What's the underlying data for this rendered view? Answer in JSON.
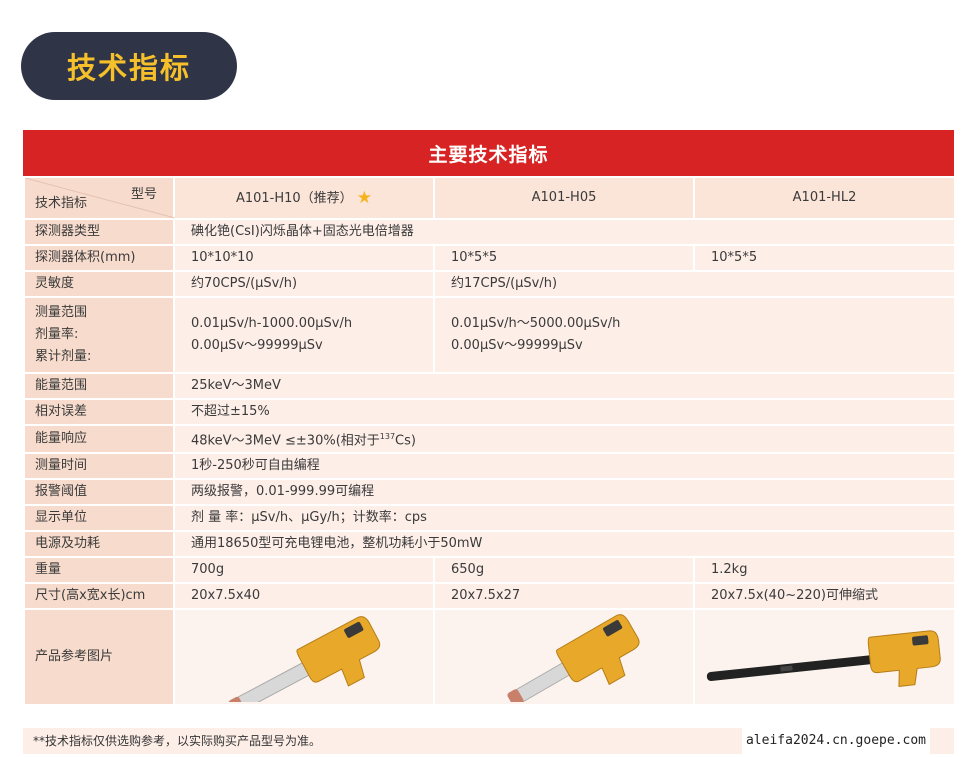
{
  "badge_title": "技术指标",
  "table_title": "主要技术指标",
  "header": {
    "corner_top": "型号",
    "corner_bottom": "技术指标",
    "models": [
      "A101-H10（推荐）",
      "A101-H05",
      "A101-HL2"
    ]
  },
  "rows": {
    "detector_type": {
      "label": "探测器类型",
      "value": "碘化铯(CsI)闪烁晶体+固态光电倍增器"
    },
    "detector_volume": {
      "label": "探测器体积(mm)",
      "v1": "10*10*10",
      "v2": "10*5*5",
      "v3": "10*5*5"
    },
    "sensitivity": {
      "label": "灵敏度",
      "v1": "约70CPS/(μSv/h)",
      "v2": "约17CPS/(μSv/h)"
    },
    "range": {
      "label1": "测量范围",
      "label2": "剂量率:",
      "label3": "累计剂量:",
      "v1a": "0.01μSv/h-1000.00μSv/h",
      "v1b": "0.00μSv～99999μSv",
      "v2a": "0.01μSv/h～5000.00μSv/h",
      "v2b": "0.00μSv～99999μSv"
    },
    "energy_range": {
      "label": "能量范围",
      "value": "25keV～3MeV"
    },
    "relative_error": {
      "label": "相对误差",
      "value": "不超过±15%"
    },
    "energy_response": {
      "label": "能量响应",
      "value_a": "48keV～3MeV ≤±30%(相对于",
      "value_sup": "137",
      "value_b": "Cs)"
    },
    "measure_time": {
      "label": "测量时间",
      "value": "1秒-250秒可自由编程"
    },
    "alarm": {
      "label": "报警阈值",
      "value": "两级报警，0.01-999.99可编程"
    },
    "display_unit": {
      "label": "显示单位",
      "value": "剂 量 率：μSv/h、μGy/h；计数率：cps"
    },
    "power": {
      "label": "电源及功耗",
      "value": "通用18650型可充电锂电池，整机功耗小于50mW"
    },
    "weight": {
      "label": "重量",
      "v1": "700g",
      "v2": "650g",
      "v3": "1.2kg"
    },
    "size": {
      "label": "尺寸(高x宽x长)cm",
      "v1": "20x7.5x40",
      "v2": "20x7.5x27",
      "v3": "20x7.5x(40~220)可伸缩式"
    },
    "images": {
      "label": "产品参考图片"
    }
  },
  "footer_note": "**技术指标仅供选购参考，以实际购买产品型号为准。",
  "watermark": "aleifa2024.cn.goepe.com",
  "colors": {
    "title_bar": "#d72323",
    "badge_bg": "#2f3546",
    "badge_text": "#f6c02b",
    "device_body": "#e8a92a"
  }
}
